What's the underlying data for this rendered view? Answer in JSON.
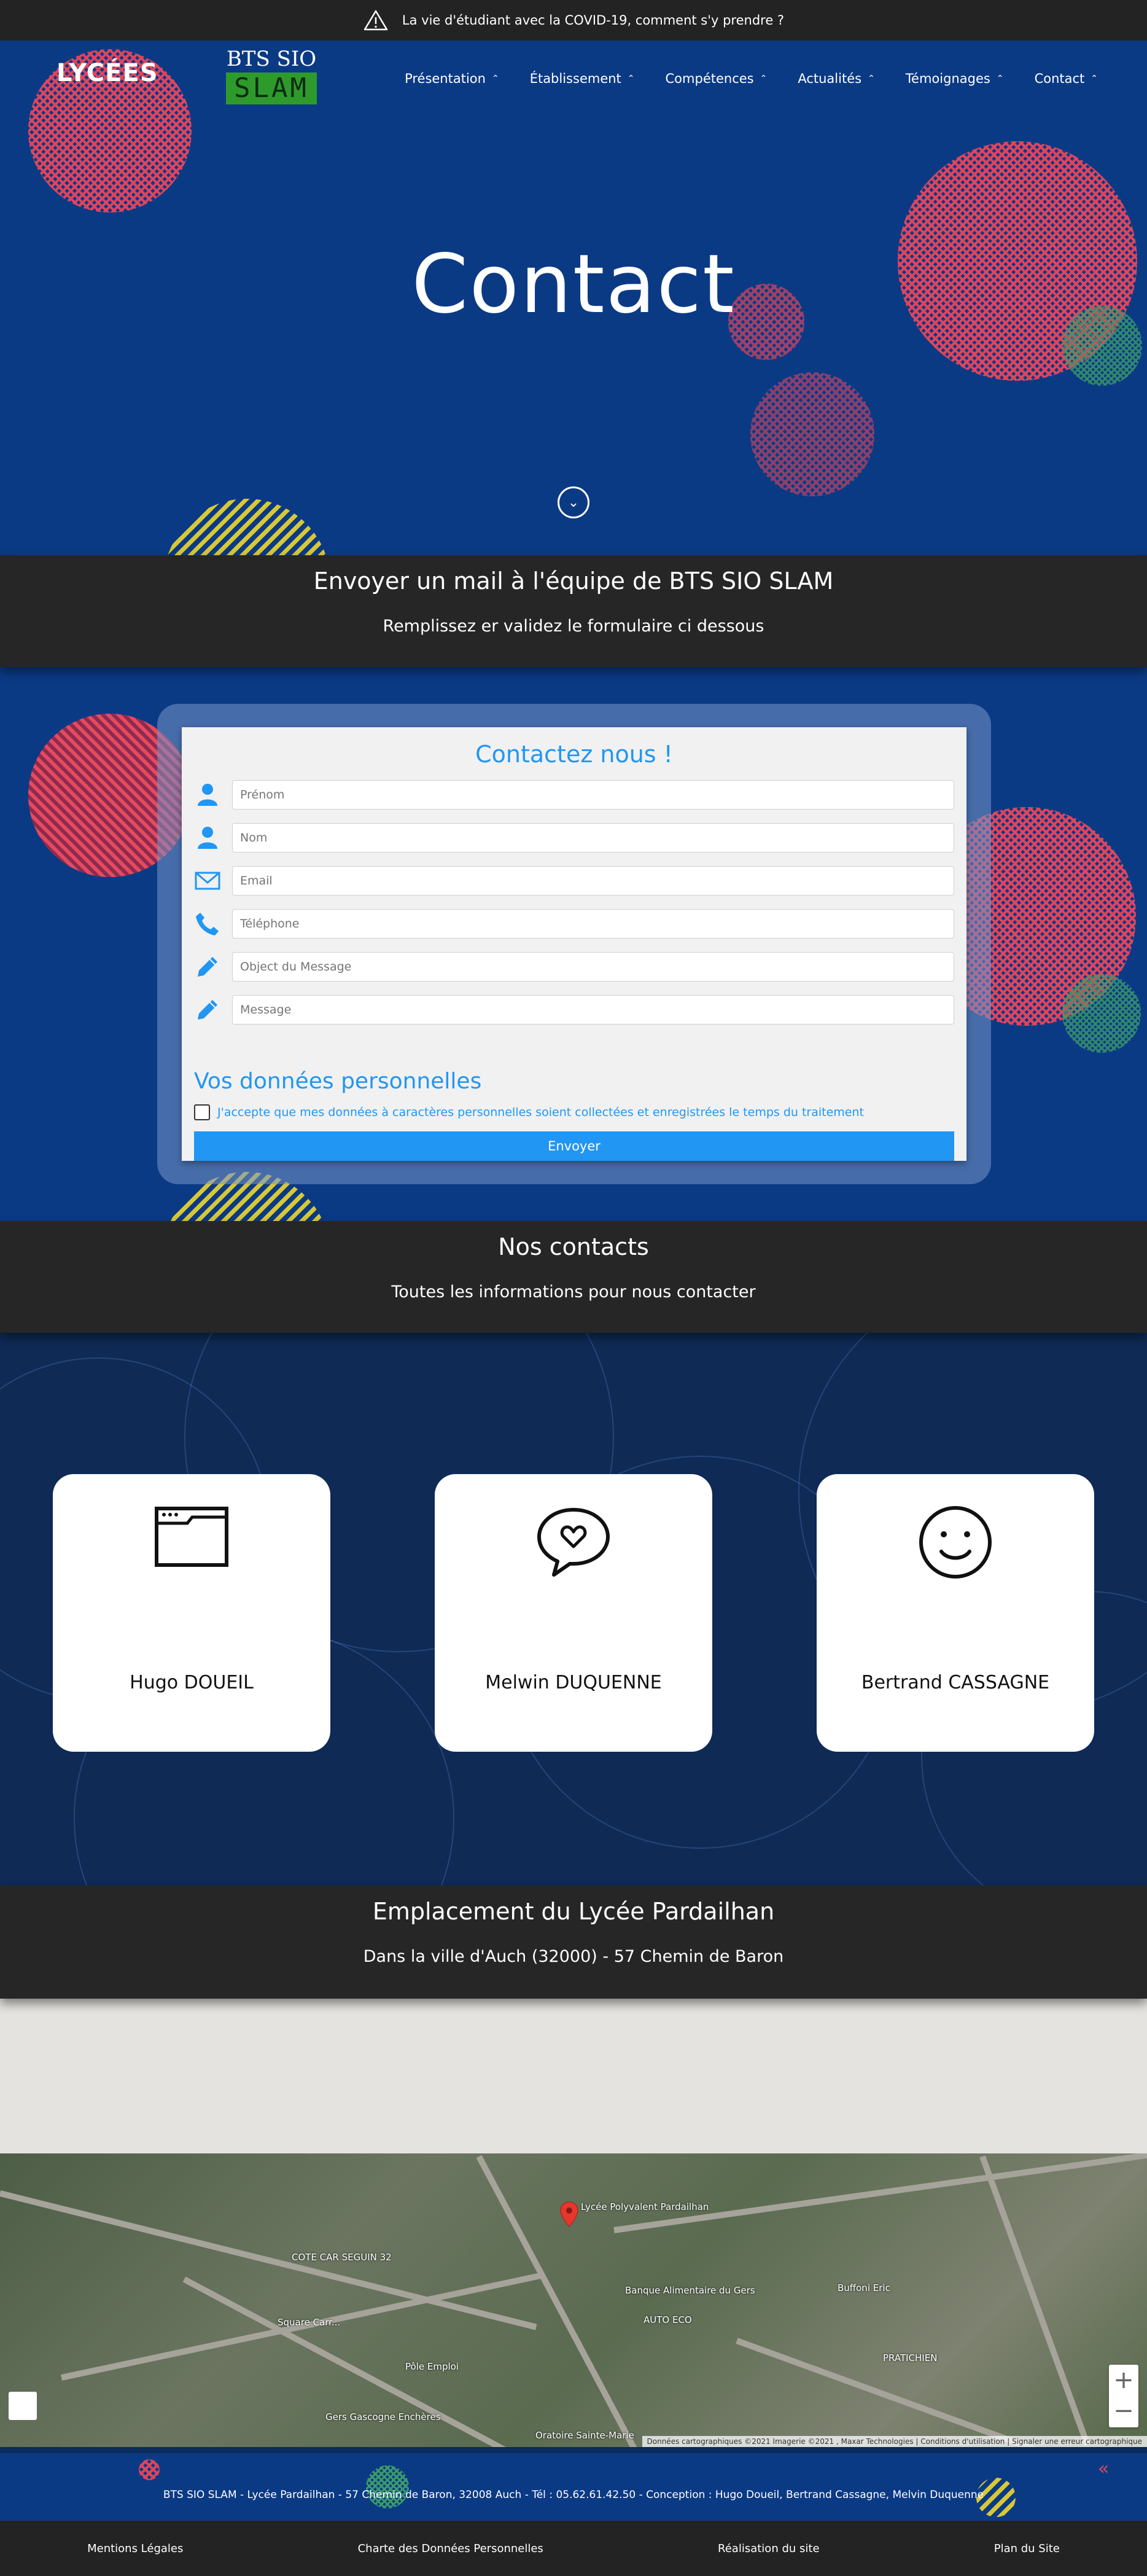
{
  "banner": {
    "text": "La vie d'étudiant avec la COVID-19, comment s'y prendre ?"
  },
  "header": {
    "logo_lycees": "LYCÉES",
    "logo_bts_top": "BTS SIO",
    "logo_bts_bottom": "SLAM",
    "nav": [
      "Présentation",
      "Établissement",
      "Compétences",
      "Actualités",
      "Témoignages",
      "Contact"
    ]
  },
  "hero": {
    "title": "Contact"
  },
  "mail_section": {
    "title": "Envoyer un mail à l'équipe de BTS SIO SLAM",
    "subtitle": "Remplissez er validez le formulaire ci dessous"
  },
  "form": {
    "title": "Contactez nous !",
    "fields": [
      {
        "placeholder": "Prénom",
        "icon": "user-icon"
      },
      {
        "placeholder": "Nom",
        "icon": "user-icon"
      },
      {
        "placeholder": "Email",
        "icon": "envelope-icon"
      },
      {
        "placeholder": "Téléphone",
        "icon": "phone-icon"
      },
      {
        "placeholder": "Object du Message",
        "icon": "pencil-icon"
      },
      {
        "placeholder": "Message",
        "icon": "pencil-icon"
      }
    ],
    "personal_title": "Vos données personnelles",
    "consent": "J'accepte que mes données à caractères personnelles soient collectées et enregistrées le temps du traitement",
    "submit": "Envoyer"
  },
  "contacts_section": {
    "title": "Nos contacts",
    "subtitle": "Toutes les informations pour nous contacter",
    "cards": [
      {
        "name": "Hugo DOUEIL",
        "icon": "browser-window-icon"
      },
      {
        "name": "Melwin DUQUENNE",
        "icon": "speech-bubble-heart-icon"
      },
      {
        "name": "Bertrand CASSAGNE",
        "icon": "smiley-icon"
      }
    ]
  },
  "location_section": {
    "title": "Emplacement du Lycée Pardailhan",
    "subtitle": "Dans la ville d'Auch (32000) - 57 Chemin de Baron"
  },
  "map": {
    "pin_label": "Lycée Polyvalent Pardailhan",
    "labels": [
      "COTE CAR SEGUIN 32",
      "Square Carr...",
      "Banque Alimentaire du Gers",
      "AUTO ECO",
      "Buffoni Eric",
      "PRATICHIEN",
      "Gers Gascogne Enchères",
      "Pôle Emploi",
      "Oratoire Sainte-Marie"
    ],
    "attribution": "Données cartographiques ©2021 Imagerie ©2021 , Maxar Technologies | Conditions d'utilisation | Signaler une erreur cartographique",
    "zoom_in": "+",
    "zoom_out": "−"
  },
  "footer": {
    "info": "BTS SIO SLAM - Lycée Pardailhan - 57 Chemin de Baron, 32008 Auch - Tél : 05.62.61.42.50 - Conception : Hugo Doueil, Bertrand Cassagne, Melvin Duquenne",
    "links": [
      "Mentions Légales",
      "Charte des Données Personnelles",
      "Réalisation du site",
      "Plan du Site"
    ]
  },
  "colors": {
    "accent": "#2196f3",
    "hero_bg": "#0b3a85",
    "dark_bar": "#262626",
    "contacts_bg": "#0e2a55"
  }
}
